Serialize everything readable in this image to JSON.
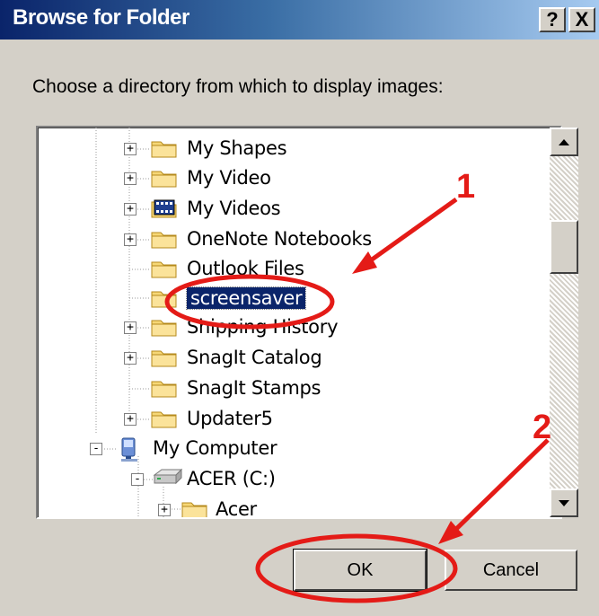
{
  "window": {
    "title": "Browse for Folder",
    "help_label": "?",
    "close_label": "X"
  },
  "prompt": "Choose a directory from which to display images:",
  "tree": {
    "items": [
      {
        "label": "My Shapes",
        "expander": "+",
        "icon": "folder-icon",
        "selected": false
      },
      {
        "label": "My Video",
        "expander": "+",
        "icon": "folder-icon",
        "selected": false
      },
      {
        "label": "My Videos",
        "expander": "+",
        "icon": "video-folder-icon",
        "selected": false
      },
      {
        "label": "OneNote Notebooks",
        "expander": "+",
        "icon": "folder-icon",
        "selected": false
      },
      {
        "label": "Outlook Files",
        "expander": "",
        "icon": "folder-icon",
        "selected": false
      },
      {
        "label": "screensaver",
        "expander": "",
        "icon": "folder-icon",
        "selected": true
      },
      {
        "label": "Shipping History",
        "expander": "+",
        "icon": "folder-icon",
        "selected": false
      },
      {
        "label": "SnagIt Catalog",
        "expander": "+",
        "icon": "folder-icon",
        "selected": false
      },
      {
        "label": "SnagIt Stamps",
        "expander": "",
        "icon": "folder-icon",
        "selected": false
      },
      {
        "label": "Updater5",
        "expander": "+",
        "icon": "folder-icon",
        "selected": false
      },
      {
        "label": "My Computer",
        "expander": "-",
        "icon": "computer-icon",
        "selected": false
      },
      {
        "label": "ACER (C:)",
        "expander": "-",
        "icon": "drive-icon",
        "selected": false
      },
      {
        "label": "Acer",
        "expander": "+",
        "icon": "folder-icon",
        "selected": false
      }
    ]
  },
  "buttons": {
    "ok": "OK",
    "cancel": "Cancel"
  },
  "annotations": {
    "step1": "1",
    "step2": "2",
    "color": "#e41b17"
  }
}
